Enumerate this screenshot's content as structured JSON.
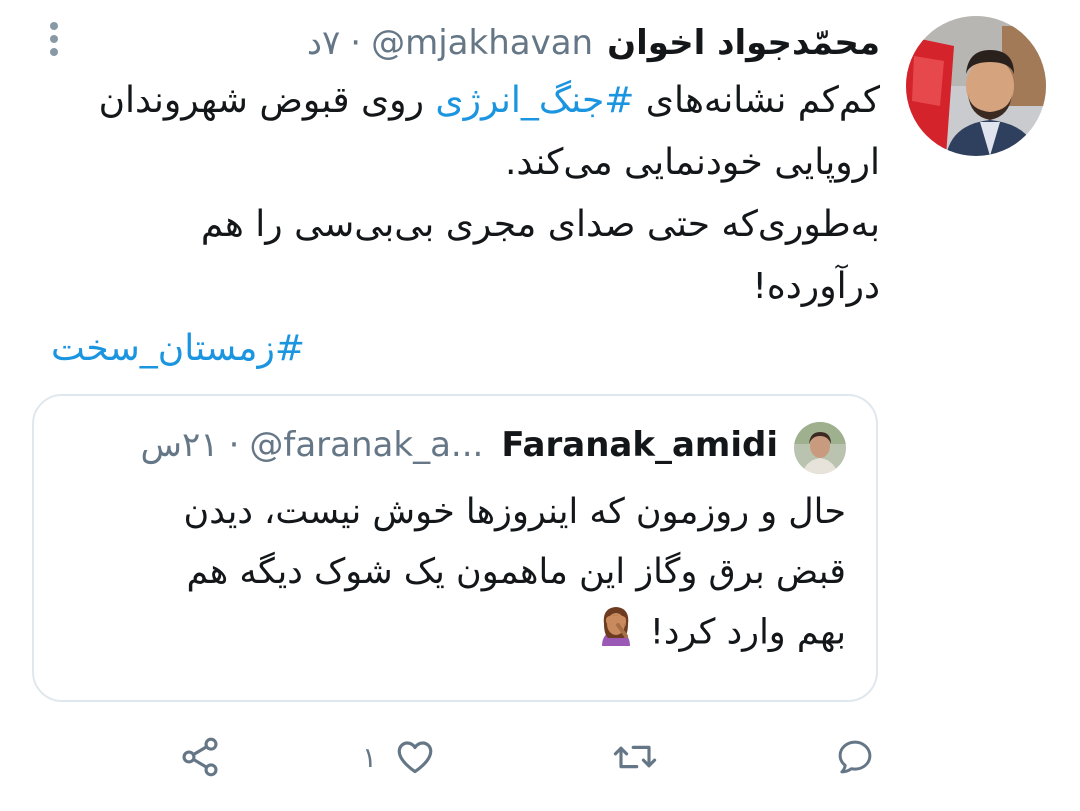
{
  "tweet": {
    "author_name": "محمّدجواد اخوان",
    "author_handle": "@mjakhavan",
    "separator": "·",
    "time": "۷د",
    "body_lines": [
      {
        "pre": "کم‌کم نشانه‌های ",
        "tag": "#جنگ_انرژی",
        "post": " روی قبوض شهروندان"
      },
      {
        "text": "اروپایی خودنمایی می‌کند."
      },
      {
        "text": "به‌طوری‌که حتی صدای مجری بی‌بی‌سی را هم"
      },
      {
        "text": "درآورده!"
      }
    ],
    "extra_hashtag": "#زمستان_سخت"
  },
  "quoted_tweet": {
    "author_name": "Faranak_amidi",
    "author_handle": "@faranak_a...",
    "separator": "·",
    "time": "۲۱س",
    "body_lines": [
      "حال و روزمون که اینروزها خوش نیست، دیدن",
      "قبض برق وگاز این ماهمون یک شوک دیگه هم",
      "بهم وارد کرد!"
    ],
    "emoji": "woman-facepalming"
  },
  "actions": {
    "reply_icon": "reply-icon",
    "retweet_icon": "retweet-icon",
    "like_icon": "like-icon",
    "like_count": "۱",
    "share_icon": "share-icon"
  },
  "colors": {
    "link": "#1b95e0",
    "secondary_text": "#657786",
    "primary_text": "#14171a",
    "border": "#e1e8ed",
    "icon": "#657786"
  }
}
